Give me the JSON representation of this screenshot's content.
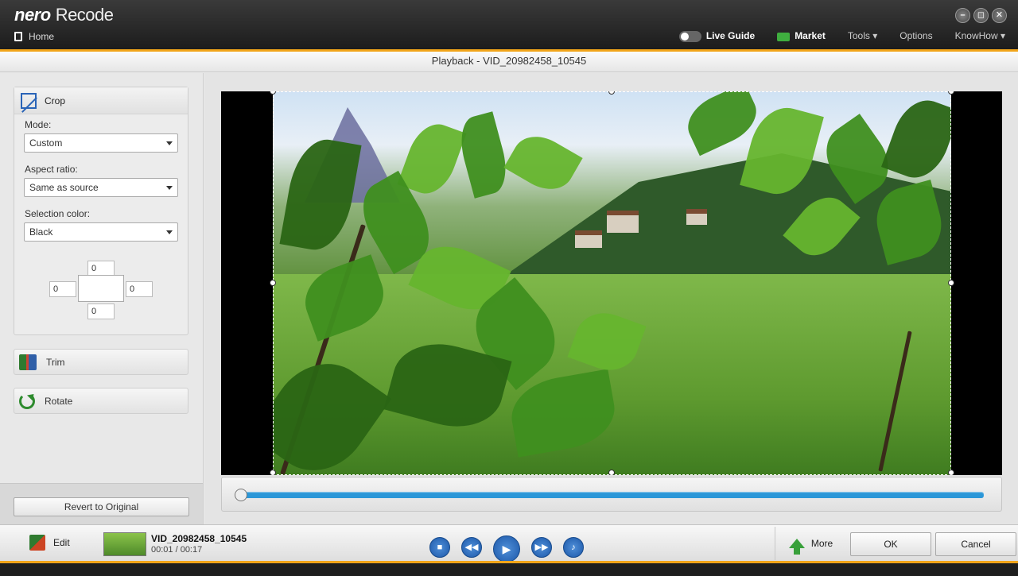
{
  "app": {
    "brand": "nero",
    "product": "Recode",
    "home_label": "Home",
    "window_controls": [
      "minimize-icon",
      "restore-icon",
      "close-icon"
    ]
  },
  "menu": {
    "live_guide": "Live Guide",
    "market": "Market",
    "tools": "Tools ▾",
    "options": "Options",
    "knowhow": "KnowHow ▾"
  },
  "subtitle": "Playback - VID_20982458_10545",
  "crop_panel": {
    "title": "Crop",
    "mode_label": "Mode:",
    "mode_value": "Custom",
    "aspect_label": "Aspect ratio:",
    "aspect_value": "Same as source",
    "color_label": "Selection color:",
    "color_value": "Black",
    "top": "0",
    "left": "0",
    "right": "0",
    "bottom": "0"
  },
  "tools": {
    "trim": "Trim",
    "rotate": "Rotate"
  },
  "revert_label": "Revert to Original",
  "bottombar": {
    "edit": "Edit",
    "file_name": "VID_20982458_10545",
    "time": "00:01 / 00:17",
    "more": "More",
    "ok": "OK",
    "cancel": "Cancel"
  },
  "playback": {
    "progress": 0.0
  },
  "colors": {
    "accent_orange": "#f2a51a",
    "timeline_blue": "#2b97d8",
    "control_blue": "#1c57a8"
  }
}
